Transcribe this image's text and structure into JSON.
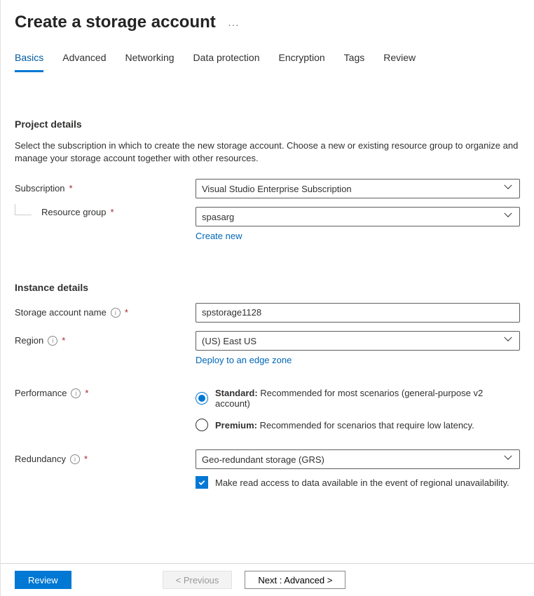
{
  "page": {
    "title": "Create a storage account"
  },
  "tabs": [
    "Basics",
    "Advanced",
    "Networking",
    "Data protection",
    "Encryption",
    "Tags",
    "Review"
  ],
  "active_tab": 0,
  "sections": {
    "project": {
      "title": "Project details",
      "desc": "Select the subscription in which to create the new storage account. Choose a new or existing resource group to organize and manage your storage account together with other resources."
    },
    "instance": {
      "title": "Instance details"
    }
  },
  "fields": {
    "subscription": {
      "label": "Subscription",
      "value": "Visual Studio Enterprise Subscription",
      "required": true
    },
    "resource_group": {
      "label": "Resource group",
      "value": "spasarg",
      "required": true,
      "create_new_label": "Create new"
    },
    "storage_name": {
      "label": "Storage account name",
      "value": "spstorage1128",
      "required": true,
      "info": true
    },
    "region": {
      "label": "Region",
      "value": "(US) East US",
      "required": true,
      "info": true,
      "edge_link": "Deploy to an edge zone"
    },
    "performance": {
      "label": "Performance",
      "required": true,
      "info": true,
      "options": [
        {
          "bold": "Standard:",
          "rest": " Recommended for most scenarios (general-purpose v2 account)",
          "selected": true
        },
        {
          "bold": "Premium:",
          "rest": " Recommended for scenarios that require low latency.",
          "selected": false
        }
      ]
    },
    "redundancy": {
      "label": "Redundancy",
      "value": "Geo-redundant storage (GRS)",
      "required": true,
      "info": true,
      "read_access_label": "Make read access to data available in the event of regional unavailability.",
      "read_access_checked": true
    }
  },
  "footer": {
    "review": "Review",
    "previous": "< Previous",
    "next": "Next : Advanced >"
  }
}
